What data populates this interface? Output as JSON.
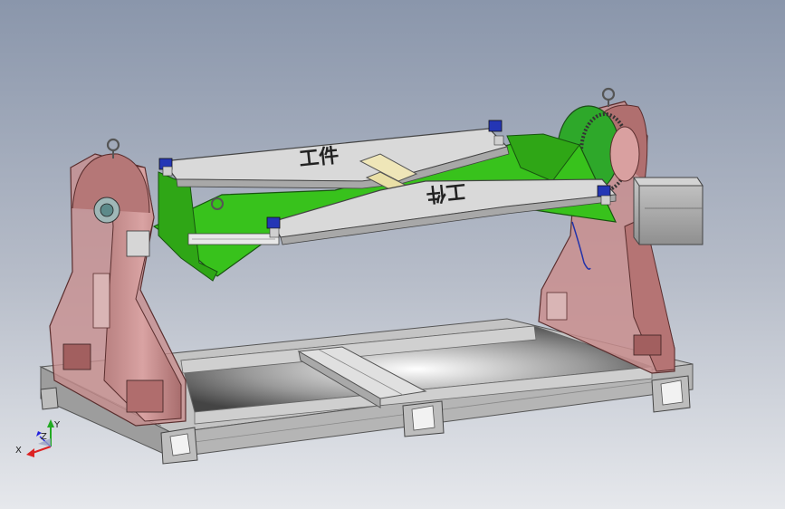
{
  "workpiece_labels": {
    "upper_arm": "工件",
    "lower_arm": "工件"
  },
  "triad": {
    "x": "X",
    "y": "Y",
    "z": "Z"
  },
  "colors": {
    "background_top": "#8a96ab",
    "background_bottom": "#e6e8ec",
    "support_pink": "#c98e8e",
    "support_dark": "#8a4b4b",
    "arm_green": "#38c21c",
    "arm_white": "#d9d9d9",
    "frame_gray": "#b9b9b9",
    "motor_box": "#a9a9a9",
    "axis_x": "#d22",
    "axis_y": "#2a2",
    "axis_z": "#22d"
  }
}
